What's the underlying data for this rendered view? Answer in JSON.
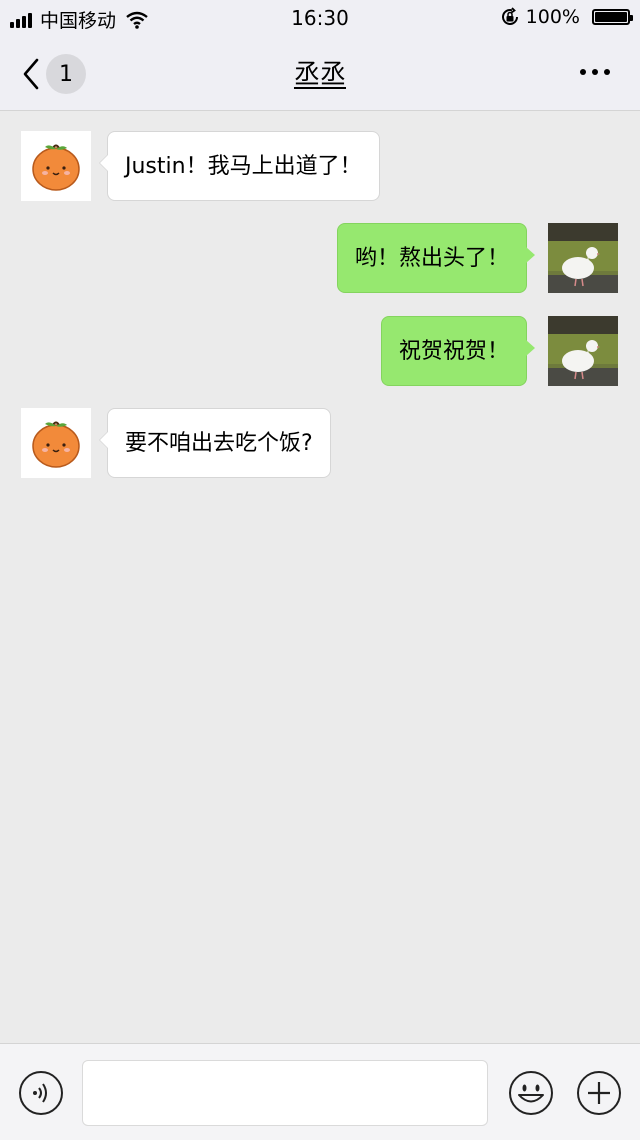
{
  "status_bar": {
    "carrier": "中国移动",
    "time": "16:30",
    "battery": "100%"
  },
  "nav": {
    "unread_count": "1",
    "title": "丞丞"
  },
  "messages": [
    {
      "direction": "in",
      "text": "Justin！我马上出道了！",
      "avatar": "orange-avatar"
    },
    {
      "direction": "out",
      "text": "哟！熬出头了！",
      "avatar": "white-bird-avatar"
    },
    {
      "direction": "out",
      "text": "祝贺祝贺！",
      "avatar": "white-bird-avatar"
    },
    {
      "direction": "in",
      "text": "要不咱出去吃个饭?",
      "avatar": "orange-avatar"
    }
  ],
  "input_bar": {
    "placeholder": "",
    "value": ""
  },
  "colors": {
    "outgoing_bubble": "#96e86f",
    "incoming_bubble": "#ffffff",
    "chat_background": "#ebebeb"
  }
}
